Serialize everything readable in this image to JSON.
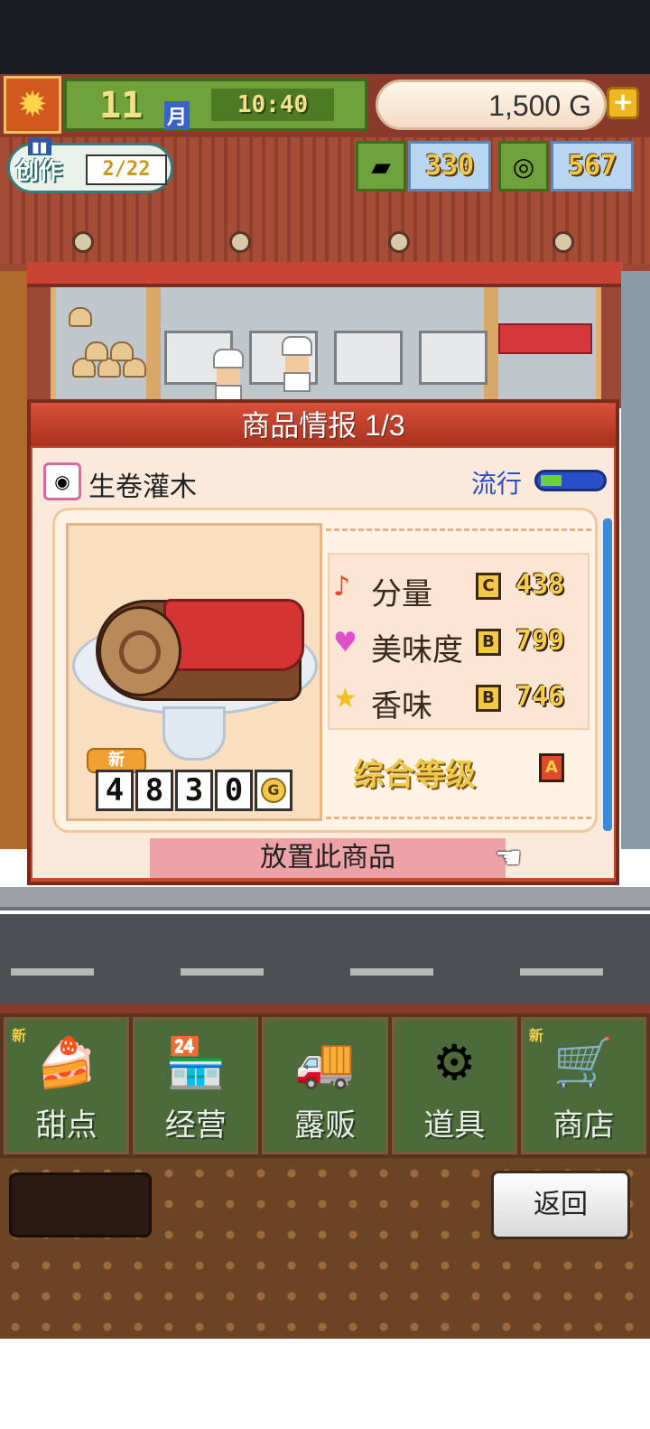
{
  "hud": {
    "month": "11",
    "month_unit": "月",
    "time": "10:40",
    "money": "1,500 G",
    "plus": "+"
  },
  "create": {
    "label": "创作",
    "progress": "2/22"
  },
  "resources": [
    {
      "icon": "gold-ingot-icon",
      "value": "330"
    },
    {
      "icon": "silver-coin-icon",
      "value": "567"
    }
  ],
  "dialog": {
    "title": "商品情报 1/3",
    "product_name": "生卷灌木",
    "trend_label": "流行",
    "trend_level": 0.35,
    "new_tag": "新",
    "price_digits": [
      "4",
      "8",
      "3",
      "0"
    ],
    "price_unit": "G",
    "stats": [
      {
        "icon": "music-note-icon",
        "label": "分量",
        "grade": "C",
        "value": "438"
      },
      {
        "icon": "heart-icon",
        "label": "美味度",
        "grade": "B",
        "value": "799"
      },
      {
        "icon": "star-icon",
        "label": "香味",
        "grade": "B",
        "value": "746"
      }
    ],
    "overall_label": "综合等级",
    "overall_grade": "A",
    "place_button": "放置此商品"
  },
  "nav": [
    {
      "label": "甜点",
      "new": "新",
      "icon": "cake-icon"
    },
    {
      "label": "经营",
      "new": "",
      "icon": "shop-building-icon"
    },
    {
      "label": "露贩",
      "new": "",
      "icon": "food-truck-icon"
    },
    {
      "label": "道具",
      "new": "",
      "icon": "gear-bag-icon"
    },
    {
      "label": "商店",
      "new": "新",
      "icon": "shopping-cart-icon"
    }
  ],
  "back_button": "返回",
  "colors": {
    "dialog_red": "#c84a2a",
    "place_button": "#eda2a8",
    "trend_blue": "#2a4ec8"
  }
}
